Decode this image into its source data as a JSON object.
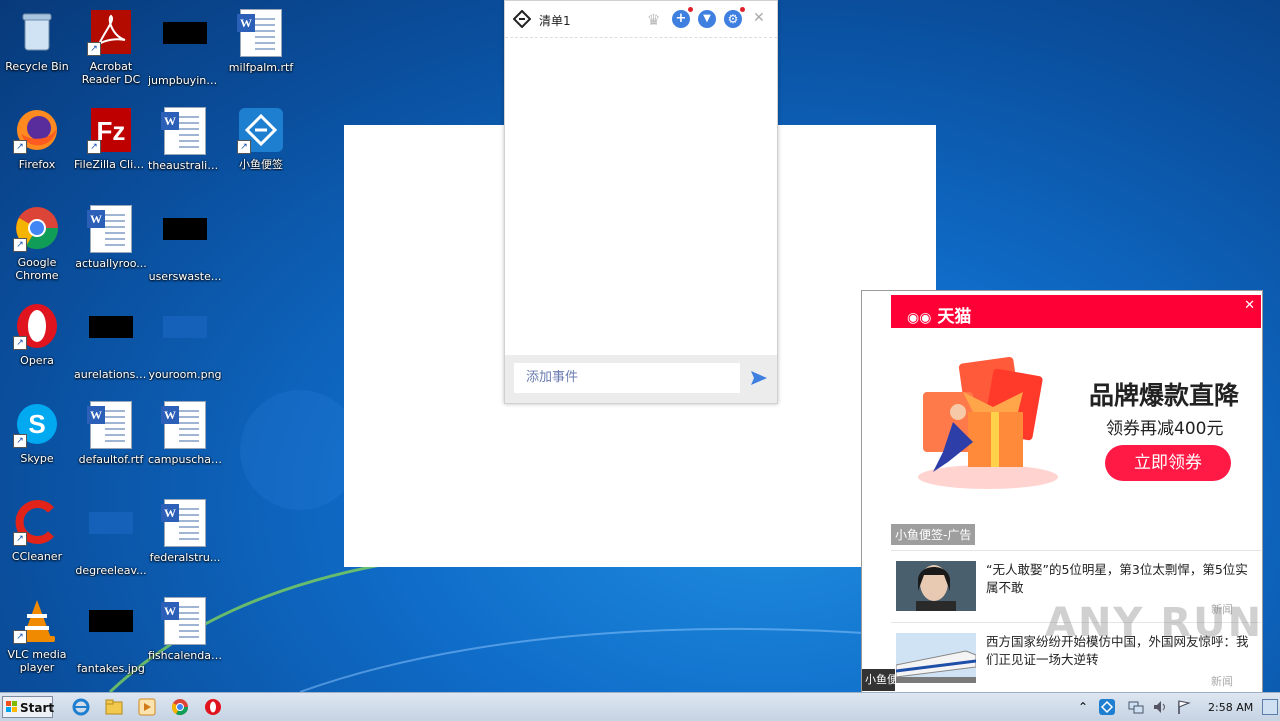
{
  "desktop": {
    "icons": [
      {
        "label": "Recycle Bin"
      },
      {
        "label": "Acrobat Reader DC"
      },
      {
        "label": "jumpbuying..."
      },
      {
        "label": "milfpalm.rtf"
      },
      {
        "label": "Firefox"
      },
      {
        "label": "FileZilla Client"
      },
      {
        "label": "theaustralia..."
      },
      {
        "label": "小鱼便签"
      },
      {
        "label": "Google Chrome"
      },
      {
        "label": "actuallyroo..."
      },
      {
        "label": "userswaste..."
      },
      {
        "label": "Opera"
      },
      {
        "label": "aurelationsh..."
      },
      {
        "label": "youroom.png"
      },
      {
        "label": "Skype"
      },
      {
        "label": "defaultof.rtf"
      },
      {
        "label": "campuschar..."
      },
      {
        "label": "CCleaner"
      },
      {
        "label": "degreeleav..."
      },
      {
        "label": "federalstru..."
      },
      {
        "label": "VLC media player"
      },
      {
        "label": "fantakes.jpg"
      },
      {
        "label": "fishcalendar..."
      }
    ]
  },
  "note_window": {
    "title": "清单1",
    "input_placeholder": "添加事件"
  },
  "ad_popup": {
    "brand": "天猫",
    "headline": "品牌爆款直降",
    "subline": "领券再减400元",
    "cta": "立即领券",
    "ad_label": "小鱼便签-广告",
    "news": [
      {
        "text": "“无人敢娶”的5位明星，第3位太剽悍，第5位实属不敢",
        "tag": "新闻"
      },
      {
        "text": "西方国家纷纷开始模仿中国，外国网友惊呼：我们正见证一场大逆转",
        "tag": "新闻"
      }
    ],
    "footer": "小鱼便签"
  },
  "watermark": "ANY RUN",
  "taskbar": {
    "start_label": "Start",
    "clock": "2:58 AM"
  },
  "colors": {
    "tmall_red": "#ff0036",
    "note_accent": "#3f7fe0"
  }
}
